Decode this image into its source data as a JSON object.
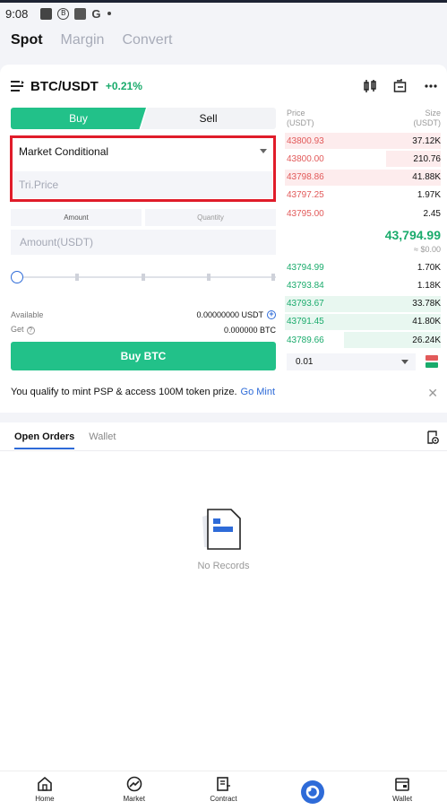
{
  "status_bar": {
    "time": "9:08"
  },
  "tabs": [
    {
      "label": "Spot"
    },
    {
      "label": "Margin"
    },
    {
      "label": "Convert"
    }
  ],
  "pair": {
    "name": "BTC/USDT",
    "change": "+0.21%"
  },
  "order_form": {
    "buy_label": "Buy",
    "sell_label": "Sell",
    "order_type": "Market Conditional",
    "trigger_price_placeholder": "Tri.Price",
    "amount_tab": "Amount",
    "quantity_tab": "Quantity",
    "amount_placeholder": "Amount(USDT)",
    "available_label": "Available",
    "available_value": "0.00000000 USDT",
    "get_label": "Get",
    "get_value": "0.000000 BTC",
    "submit_label": "Buy BTC"
  },
  "order_book": {
    "price_header": "Price",
    "price_unit": "(USDT)",
    "size_header": "Size",
    "size_unit": "(USDT)",
    "asks": [
      {
        "price": "43800.93",
        "size": "37.12K",
        "depth": 1.0
      },
      {
        "price": "43800.00",
        "size": "210.76",
        "depth": 0.35
      },
      {
        "price": "43798.86",
        "size": "41.88K",
        "depth": 1.0
      },
      {
        "price": "43797.25",
        "size": "1.97K",
        "depth": 0.0
      },
      {
        "price": "43795.00",
        "size": "2.45",
        "depth": 0.0
      }
    ],
    "last_price": "43,794.99",
    "last_price_fiat": "≈ $0.00",
    "bids": [
      {
        "price": "43794.99",
        "size": "1.70K",
        "depth": 0.0
      },
      {
        "price": "43793.84",
        "size": "1.18K",
        "depth": 0.0
      },
      {
        "price": "43793.67",
        "size": "33.78K",
        "depth": 1.0
      },
      {
        "price": "43791.45",
        "size": "41.80K",
        "depth": 1.0
      },
      {
        "price": "43789.66",
        "size": "26.24K",
        "depth": 0.62
      }
    ],
    "depth_value": "0.01"
  },
  "promo": {
    "text": "You qualify to mint PSP & access 100M token prize.",
    "link": "Go Mint"
  },
  "orders": {
    "tab_open": "Open Orders",
    "tab_wallet": "Wallet",
    "empty_text": "No Records"
  },
  "bottom_nav": [
    {
      "label": "Home"
    },
    {
      "label": "Market"
    },
    {
      "label": "Contract"
    },
    {
      "label": ""
    },
    {
      "label": "Wallet"
    }
  ],
  "colors": {
    "green": "#22c189",
    "red": "#e25a5a",
    "accent": "#2e6bd8",
    "highlight": "#e01c2a"
  }
}
